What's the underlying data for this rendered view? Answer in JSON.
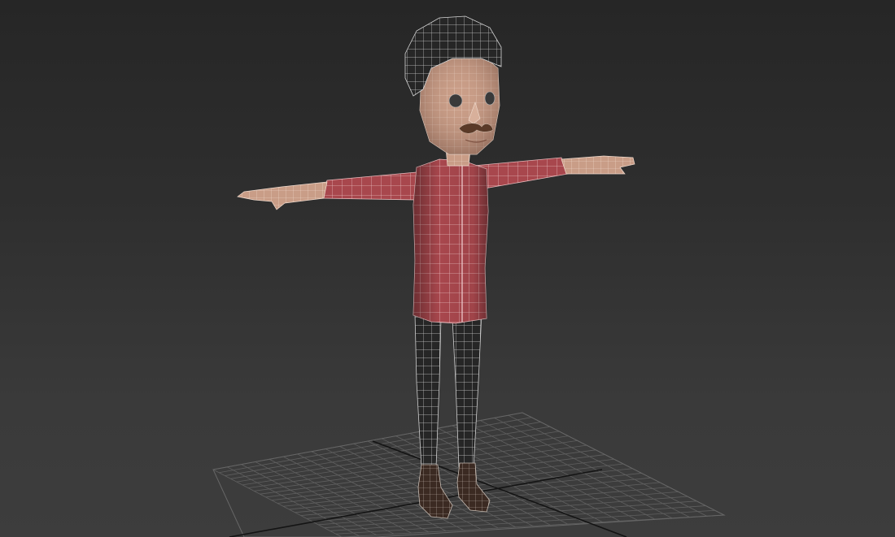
{
  "viewport": {
    "background_top": "#262626",
    "background_bottom": "#3d3d3d",
    "grid_color": "#6c6c6c",
    "grid_axis_color": "#111111"
  },
  "model": {
    "shirt_color": "#a8474d",
    "skin_color": "#c89c86",
    "hat_color": "#2e2e2e",
    "pants_color": "#2a2a2a",
    "boots_color": "#3a2a22",
    "wire_color": "#d8d8d8"
  }
}
